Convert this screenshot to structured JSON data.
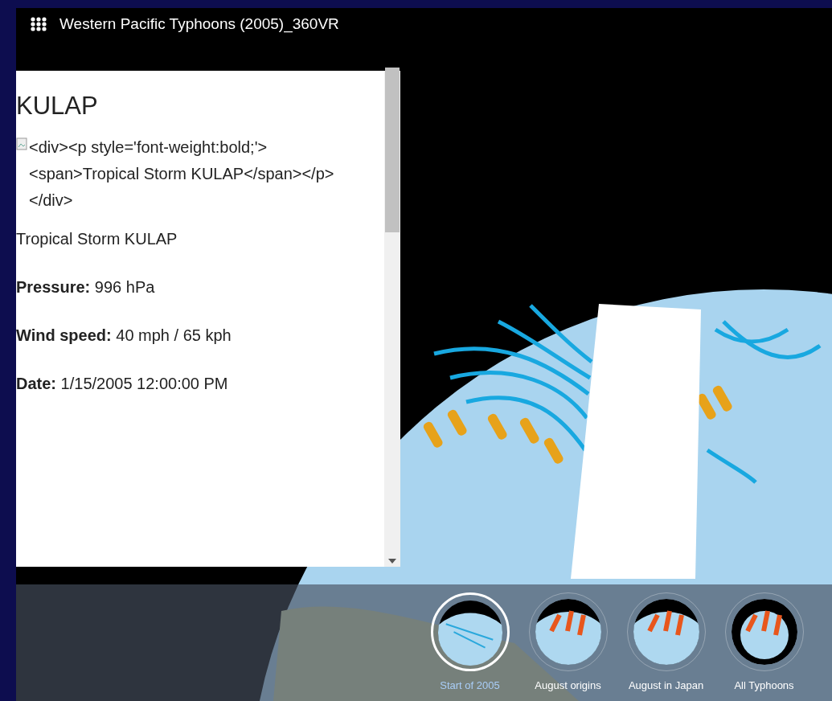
{
  "app_title": "Western Pacific Typhoons (2005)_360VR",
  "popup": {
    "title": "KULAP",
    "image_alt": "<div><p style='font-weight:bold;'><span>Tropical Storm KULAP</span></p></div>",
    "heading": "Tropical Storm KULAP",
    "fields": [
      {
        "label": "Pressure:",
        "value": "996 hPa"
      },
      {
        "label": "Wind speed:",
        "value": "40 mph / 65 kph"
      },
      {
        "label": "Date:",
        "value": "1/15/2005 12:00:00 PM"
      }
    ]
  },
  "slides": [
    {
      "label": "Start of 2005",
      "selected": true
    },
    {
      "label": "August origins",
      "selected": false
    },
    {
      "label": "August in Japan",
      "selected": false
    },
    {
      "label": "All Typhoons",
      "selected": false
    }
  ]
}
